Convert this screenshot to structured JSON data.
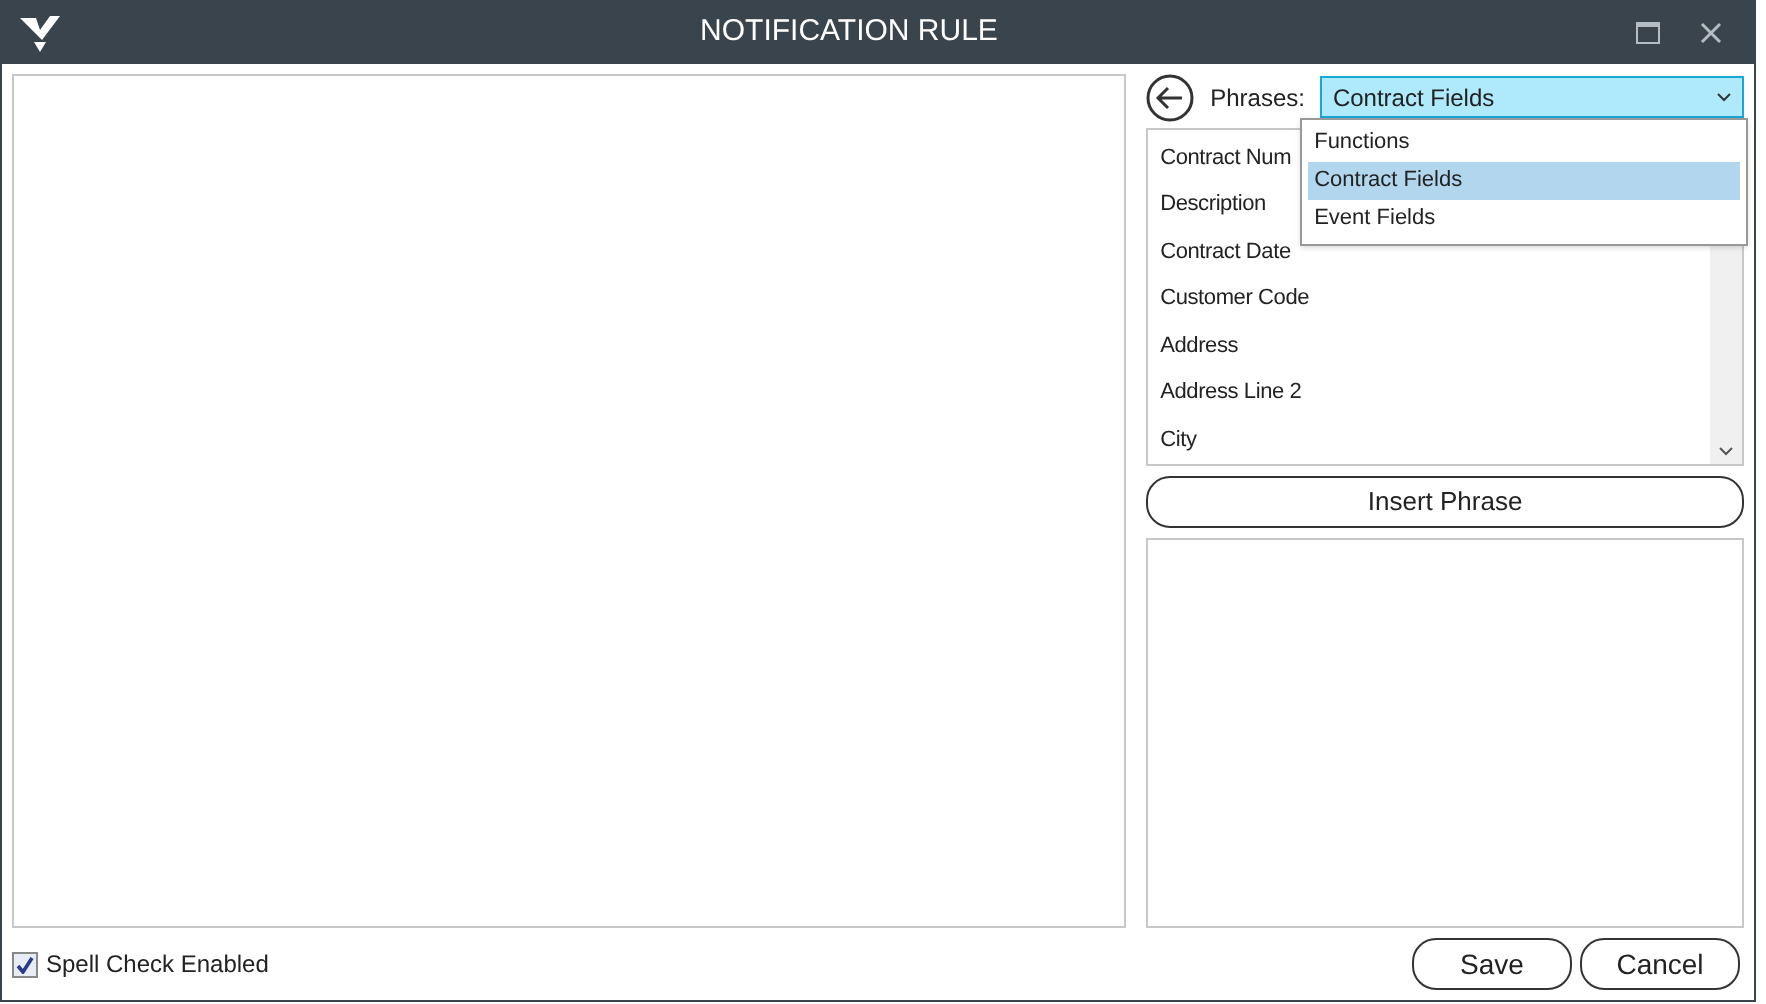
{
  "window": {
    "title": "NOTIFICATION RULE"
  },
  "phrases": {
    "label": "Phrases:",
    "value": "Contract Fields",
    "expanded": true,
    "options": [
      {
        "label": "Functions",
        "selected": false
      },
      {
        "label": "Contract Fields",
        "selected": true
      },
      {
        "label": "Event Fields",
        "selected": false
      }
    ],
    "items": [
      "Contract Num",
      "Description",
      "Contract Date",
      "Customer Code",
      "Address",
      "Address Line 2",
      "City"
    ]
  },
  "insert_button": "Insert Phrase",
  "spell_check": {
    "label": "Spell Check Enabled",
    "checked": true
  },
  "buttons": [
    "Save",
    "Cancel"
  ]
}
